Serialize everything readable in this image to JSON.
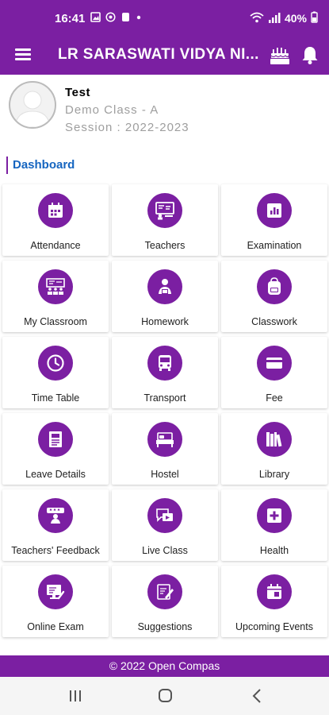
{
  "status_bar": {
    "time": "16:41",
    "battery": "40%"
  },
  "app_bar": {
    "title": "LR SARASWATI VIDYA NI...",
    "menu_icon": "hamburger-icon",
    "birthday_icon": "cake-icon",
    "notification_icon": "bell-icon"
  },
  "profile": {
    "name": "Test",
    "class": "Demo Class - A",
    "session": "Session : 2022-2023"
  },
  "section": {
    "title": "Dashboard"
  },
  "colors": {
    "primary": "#7b1fa2",
    "link": "#1565c0"
  },
  "tiles": [
    {
      "label": "Attendance",
      "icon": "calendar-icon"
    },
    {
      "label": "Teachers",
      "icon": "teacher-board-icon"
    },
    {
      "label": "Examination",
      "icon": "chart-report-icon"
    },
    {
      "label": "My Classroom",
      "icon": "classroom-icon"
    },
    {
      "label": "Homework",
      "icon": "student-homework-icon"
    },
    {
      "label": "Classwork",
      "icon": "backpack-icon"
    },
    {
      "label": "Time Table",
      "icon": "clock-icon"
    },
    {
      "label": "Transport",
      "icon": "bus-icon"
    },
    {
      "label": "Fee",
      "icon": "card-icon"
    },
    {
      "label": "Leave Details",
      "icon": "document-icon"
    },
    {
      "label": "Hostel",
      "icon": "bed-icon"
    },
    {
      "label": "Library",
      "icon": "books-icon"
    },
    {
      "label": "Teachers' Feedback",
      "icon": "feedback-icon"
    },
    {
      "label": "Live Class",
      "icon": "video-chat-icon"
    },
    {
      "label": "Health",
      "icon": "medical-plus-icon"
    },
    {
      "label": "Online Exam",
      "icon": "monitor-exam-icon"
    },
    {
      "label": "Suggestions",
      "icon": "pencil-note-icon"
    },
    {
      "label": "Upcoming Events",
      "icon": "event-calendar-icon"
    }
  ],
  "footer": {
    "text": "© 2022 Open Compas"
  }
}
